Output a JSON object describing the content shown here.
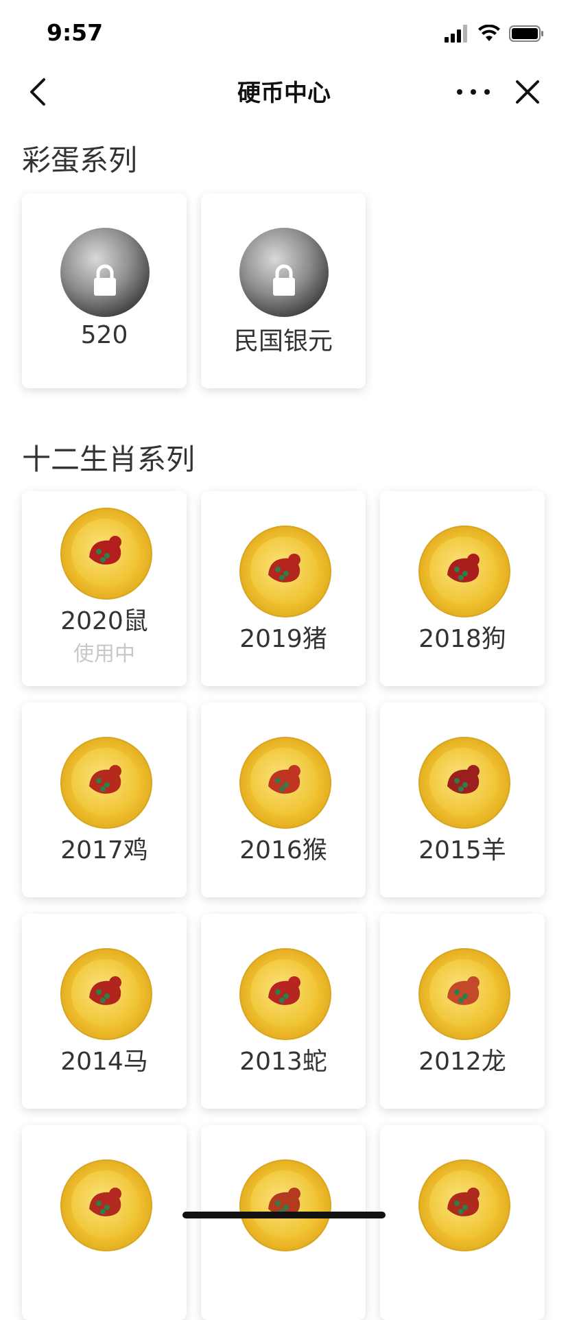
{
  "status_bar": {
    "time": "9:57"
  },
  "nav": {
    "title": "硬币中心"
  },
  "sections": [
    {
      "title": "彩蛋系列",
      "items": [
        {
          "label": "520",
          "style": "silver",
          "locked": true,
          "sublabel": ""
        },
        {
          "label": "民国银元",
          "style": "silver",
          "locked": true,
          "sublabel": ""
        }
      ]
    },
    {
      "title": "十二生肖系列",
      "items": [
        {
          "label": "2020鼠",
          "style": "gold",
          "motif_color": "#b21e1e",
          "sublabel": "使用中"
        },
        {
          "label": "2019猪",
          "style": "gold",
          "motif_color": "#b3261e",
          "sublabel": ""
        },
        {
          "label": "2018狗",
          "style": "gold",
          "motif_color": "#a91d1d",
          "sublabel": ""
        },
        {
          "label": "2017鸡",
          "style": "gold",
          "motif_color": "#b42a1c",
          "sublabel": ""
        },
        {
          "label": "2016猴",
          "style": "gold",
          "motif_color": "#c03522",
          "sublabel": ""
        },
        {
          "label": "2015羊",
          "style": "gold",
          "motif_color": "#9c1f20",
          "sublabel": ""
        },
        {
          "label": "2014马",
          "style": "gold",
          "motif_color": "#b1251f",
          "sublabel": ""
        },
        {
          "label": "2013蛇",
          "style": "gold",
          "motif_color": "#b62520",
          "sublabel": ""
        },
        {
          "label": "2012龙",
          "style": "gold",
          "motif_color": "#c24a2a",
          "sublabel": ""
        },
        {
          "label": "",
          "style": "gold",
          "motif_color": "#b22a1f",
          "sublabel": ""
        },
        {
          "label": "",
          "style": "gold",
          "motif_color": "#b23a1f",
          "sublabel": ""
        },
        {
          "label": "",
          "style": "gold",
          "motif_color": "#ad2a1d",
          "sublabel": ""
        }
      ]
    }
  ],
  "colors": {
    "gold": "#f1c232",
    "motif_green": "#2f7d4a",
    "active_gray": "#c8c8c8"
  }
}
